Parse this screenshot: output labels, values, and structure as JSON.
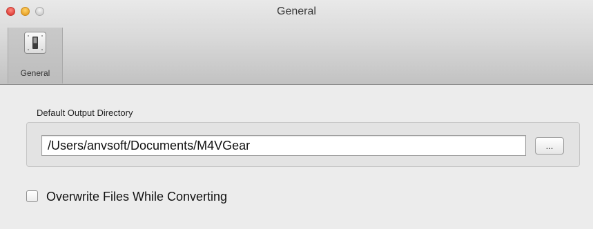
{
  "window": {
    "title": "General"
  },
  "toolbar": {
    "items": [
      {
        "label": "General",
        "icon": "general-switch-icon",
        "selected": true
      }
    ]
  },
  "output": {
    "group_title": "Default Output Directory",
    "path_value": "/Users/anvsoft/Documents/M4VGear",
    "browse_label": "..."
  },
  "options": {
    "overwrite_label": "Overwrite Files While Converting",
    "overwrite_checked": false
  }
}
